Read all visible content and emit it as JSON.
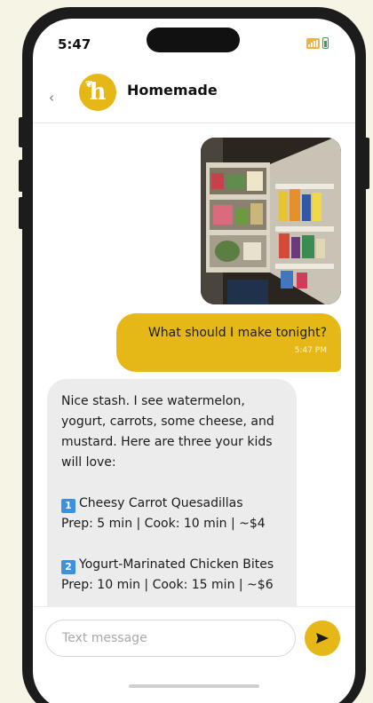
{
  "status_bar": {
    "time": "5:47"
  },
  "header": {
    "back_icon": "chevron-left",
    "avatar_letter": "h",
    "title": "Homemade"
  },
  "messages": {
    "outgoing": {
      "text": "What should I make tonight?",
      "time": "5:47 PM"
    },
    "incoming": {
      "intro": "Nice stash. I see watermelon, yogurt, carrots, some cheese, and mustard. Here are three your kids will love:",
      "recipes": [
        {
          "num": "1",
          "name": "Cheesy Carrot Quesadillas",
          "meta": "Prep: 5 min | Cook: 10 min | ~$4"
        },
        {
          "num": "2",
          "name": "Yogurt-Marinated Chicken Bites",
          "meta": "Prep: 10 min | Cook: 15 min | ~$6"
        }
      ]
    }
  },
  "composer": {
    "placeholder": "Text message",
    "send_icon": "paper-plane"
  },
  "colors": {
    "accent": "#e6b817",
    "background": "#f6f4e4",
    "incoming_bubble": "#ececec"
  }
}
